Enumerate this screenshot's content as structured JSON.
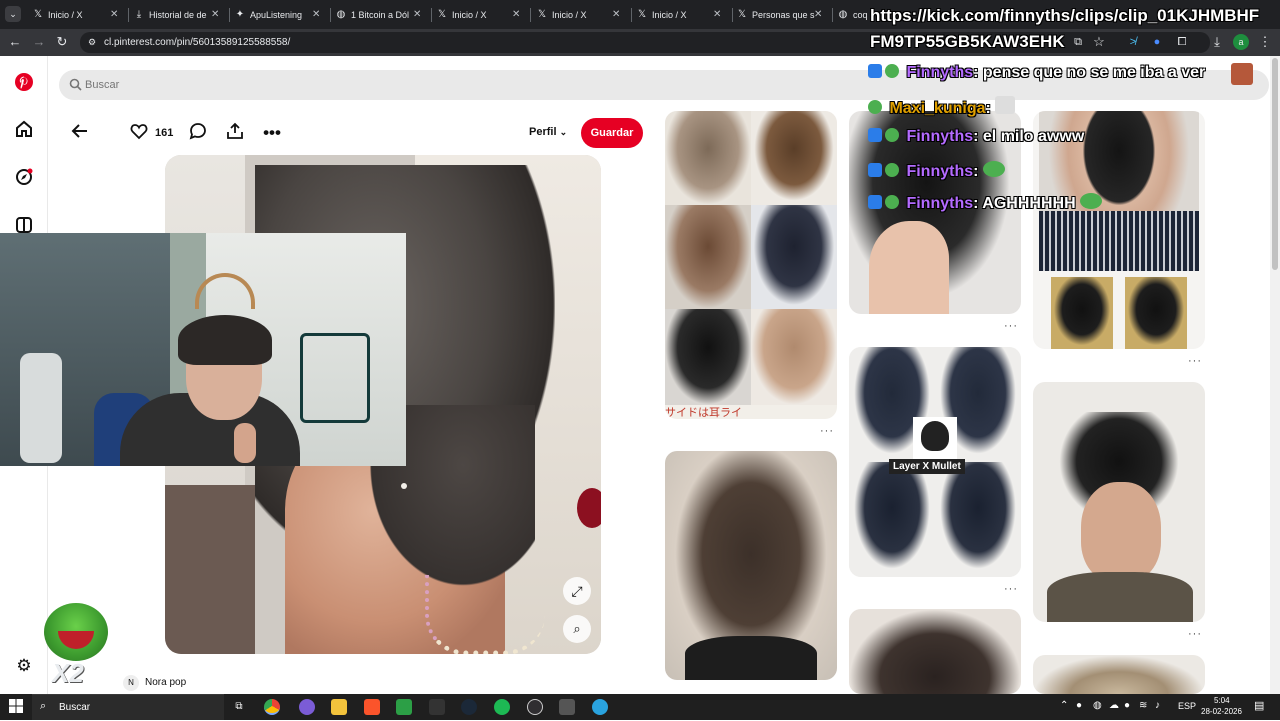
{
  "browser": {
    "tabs": [
      {
        "label": "Inicio / X",
        "icon": "x-logo-icon"
      },
      {
        "label": "Historial de de",
        "icon": "download-icon"
      },
      {
        "label": "ApuListening",
        "icon": "twitter-bird-icon"
      },
      {
        "label": "1 Bitcoin a Dól",
        "icon": "globe-icon"
      },
      {
        "label": "Inicio / X",
        "icon": "x-logo-icon"
      },
      {
        "label": "Inicio / X",
        "icon": "x-logo-icon"
      },
      {
        "label": "Inicio / X",
        "icon": "x-logo-icon"
      },
      {
        "label": "Personas que s",
        "icon": "x-logo-icon"
      },
      {
        "label": "coq",
        "icon": "globe-icon"
      }
    ],
    "url": "cl.pinterest.com/pin/56013589125588558/",
    "profile_initial": "a"
  },
  "overlay": {
    "clip_url_line1": "https://kick.com/finnyths/clips/clip_01KJHMBHF",
    "clip_url_line2": "FM9TP55GB5KAW3EHK",
    "chat": [
      {
        "user": "Finnyths",
        "message": ": pense que no se me iba a ver",
        "color": "#b46bff"
      },
      {
        "user": "Maxi_kuniga",
        "message": ":",
        "color": "#e0a000"
      },
      {
        "user": "Finnyths",
        "message": ": el milo awww",
        "color": "#b46bff"
      },
      {
        "user": "Finnyths",
        "message": ":",
        "color": "#b46bff"
      },
      {
        "user": "Finnyths",
        "message": ": AGHHHHHH",
        "color": "#b46bff"
      }
    ],
    "emote_text": "X2"
  },
  "pinterest": {
    "search_placeholder": "Buscar",
    "like_count": "161",
    "profile_label": "Perfil",
    "save_label": "Guardar",
    "author_initial": "N",
    "author_name": "Nora pop",
    "collage_caption": "サイドは耳ライ",
    "mullet_caption": "Layer X Mullet",
    "more_label": "···"
  },
  "taskbar": {
    "search_placeholder": "Buscar",
    "language": "ESP",
    "time": "5:04",
    "date": "28-02-2026"
  },
  "colors": {
    "brand": "#e60023",
    "chrome_dark": "#202124"
  }
}
